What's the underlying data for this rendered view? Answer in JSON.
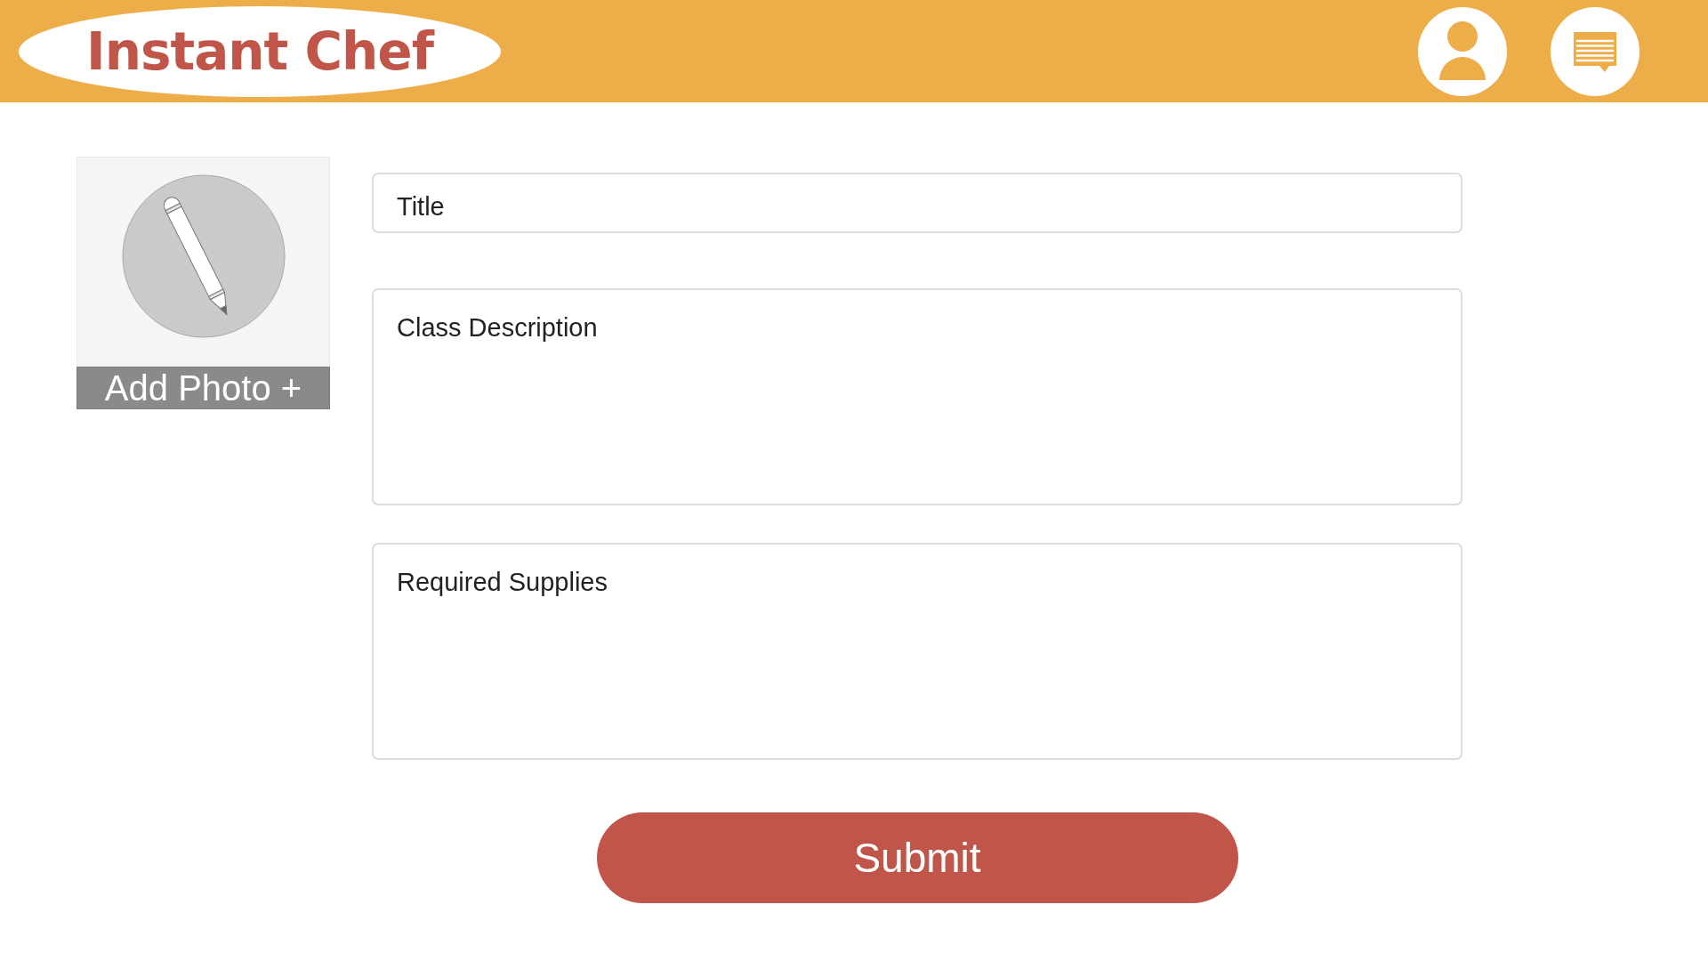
{
  "header": {
    "logo": "Instant Chef"
  },
  "photo_upload": {
    "label": "Add Photo +"
  },
  "form": {
    "fields": [
      {
        "kind": "line",
        "placeholder": "Title"
      },
      {
        "kind": "area",
        "placeholder": "Class Description"
      },
      {
        "kind": "area",
        "placeholder": "Required Supplies"
      }
    ],
    "submit": "Submit"
  }
}
